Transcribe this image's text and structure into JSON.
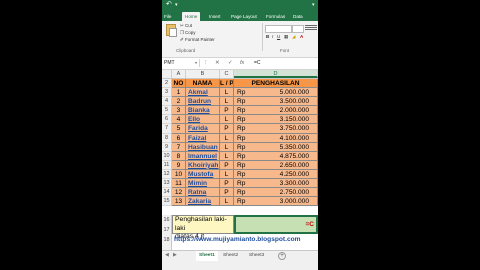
{
  "qat": {
    "undo_icon": "undo-icon",
    "redo_icon": "redo-icon",
    "save_icon": "save-icon"
  },
  "ribbon": {
    "tabs": [
      "File",
      "Home",
      "Insert",
      "Page Layout",
      "Formulas",
      "Data"
    ],
    "active_tab": "Home",
    "cut": "Cut",
    "copy": "Copy",
    "format_painter": "Format Painter",
    "group_clipboard": "Clipboard",
    "group_font": "Font"
  },
  "formula_bar": {
    "name_box": "PMT",
    "formula": "=C"
  },
  "columns": [
    "A",
    "B",
    "C",
    "D"
  ],
  "table": {
    "headers": [
      "NO",
      "NAMA",
      "L / P",
      "PENGHASILAN"
    ],
    "currency": "Rp",
    "rows": [
      {
        "row": "3",
        "no": "1",
        "nama": "Akmal",
        "lp": "L",
        "amount": "5.000.000"
      },
      {
        "row": "4",
        "no": "2",
        "nama": "Badrun",
        "lp": "L",
        "amount": "3.500.000"
      },
      {
        "row": "5",
        "no": "3",
        "nama": "Bianka",
        "lp": "P",
        "amount": "2.000.000"
      },
      {
        "row": "6",
        "no": "4",
        "nama": "Ello",
        "lp": "L",
        "amount": "3.150.000"
      },
      {
        "row": "7",
        "no": "5",
        "nama": "Farida",
        "lp": "P",
        "amount": "3.750.000"
      },
      {
        "row": "8",
        "no": "6",
        "nama": "Faizal",
        "lp": "L",
        "amount": "4.100.000"
      },
      {
        "row": "9",
        "no": "7",
        "nama": "Hasibuan",
        "lp": "L",
        "amount": "5.350.000"
      },
      {
        "row": "10",
        "no": "8",
        "nama": "Imannuel",
        "lp": "L",
        "amount": "4.875.000"
      },
      {
        "row": "11",
        "no": "9",
        "nama": "Khoiriyah",
        "lp": "P",
        "amount": "2.650.000"
      },
      {
        "row": "12",
        "no": "10",
        "nama": "Mustofa",
        "lp": "L",
        "amount": "4.250.000"
      },
      {
        "row": "13",
        "no": "11",
        "nama": "Mimin",
        "lp": "P",
        "amount": "3.300.000"
      },
      {
        "row": "14",
        "no": "12",
        "nama": "Ratna",
        "lp": "P",
        "amount": "2.750.000"
      },
      {
        "row": "15",
        "no": "13",
        "nama": "Zakaria",
        "lp": "L",
        "amount": "3.000.000"
      }
    ],
    "header_row": "2",
    "col_row": "1"
  },
  "note": {
    "line1": "Penghasilan laki-laki",
    "line2": "diatas 4 jt",
    "row16": "16",
    "row17": "17",
    "row18": "18"
  },
  "result_text": "=C",
  "url": "https://www.mujiyamianto.blogspot.com",
  "sheets": [
    "Sheet1",
    "Sheet2",
    "Sheet3"
  ],
  "active_sheet": "Sheet1",
  "colors": {
    "excel_green": "#217346",
    "header_orange": "#f79646",
    "body_orange": "#f7b88c",
    "note_yellow": "#fff7c2",
    "result_green": "#c6e0b4"
  }
}
